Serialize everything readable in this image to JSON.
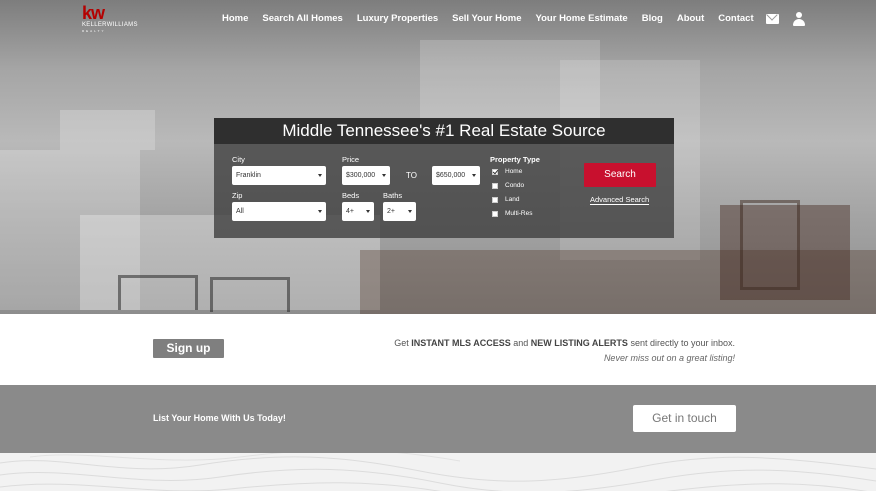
{
  "logo": {
    "mark": "kw",
    "name": "KELLERWILLIAMS",
    "sub": "REALTY"
  },
  "nav": {
    "items": [
      "Home",
      "Search All Homes",
      "Luxury Properties",
      "Sell Your Home",
      "Your Home Estimate",
      "Blog",
      "About",
      "Contact"
    ]
  },
  "header_icons": [
    "mail-icon",
    "user-icon"
  ],
  "search": {
    "title": "Middle Tennessee's #1 Real Estate Source",
    "city_label": "City",
    "city_value": "Franklin",
    "price_label": "Price",
    "price_min": "$300,000",
    "to_label": "TO",
    "price_max": "$650,000",
    "zip_label": "Zip",
    "zip_value": "All",
    "beds_label": "Beds",
    "beds_value": "4+",
    "baths_label": "Baths",
    "baths_value": "2+",
    "property_type_label": "Property Type",
    "property_types": [
      {
        "label": "Home",
        "checked": true
      },
      {
        "label": "Condo",
        "checked": false
      },
      {
        "label": "Land",
        "checked": false
      },
      {
        "label": "Multi-Res",
        "checked": false
      }
    ],
    "search_button": "Search",
    "advanced_link": "Advanced Search"
  },
  "signup": {
    "button": "Sign up",
    "line1_pre": "Get ",
    "line1_b1": "INSTANT MLS ACCESS",
    "line1_mid": " and ",
    "line1_b2": "NEW LISTING ALERTS",
    "line1_post": " sent directly to your inbox.",
    "line2": "Never miss out on a great listing!"
  },
  "list_home": {
    "text": "List Your Home With Us Today!",
    "button": "Get in touch"
  },
  "colors": {
    "accent": "#c8102e",
    "brand": "#b40101",
    "band_gray": "#8a8a8a",
    "button_gray": "#7f7f7f"
  }
}
